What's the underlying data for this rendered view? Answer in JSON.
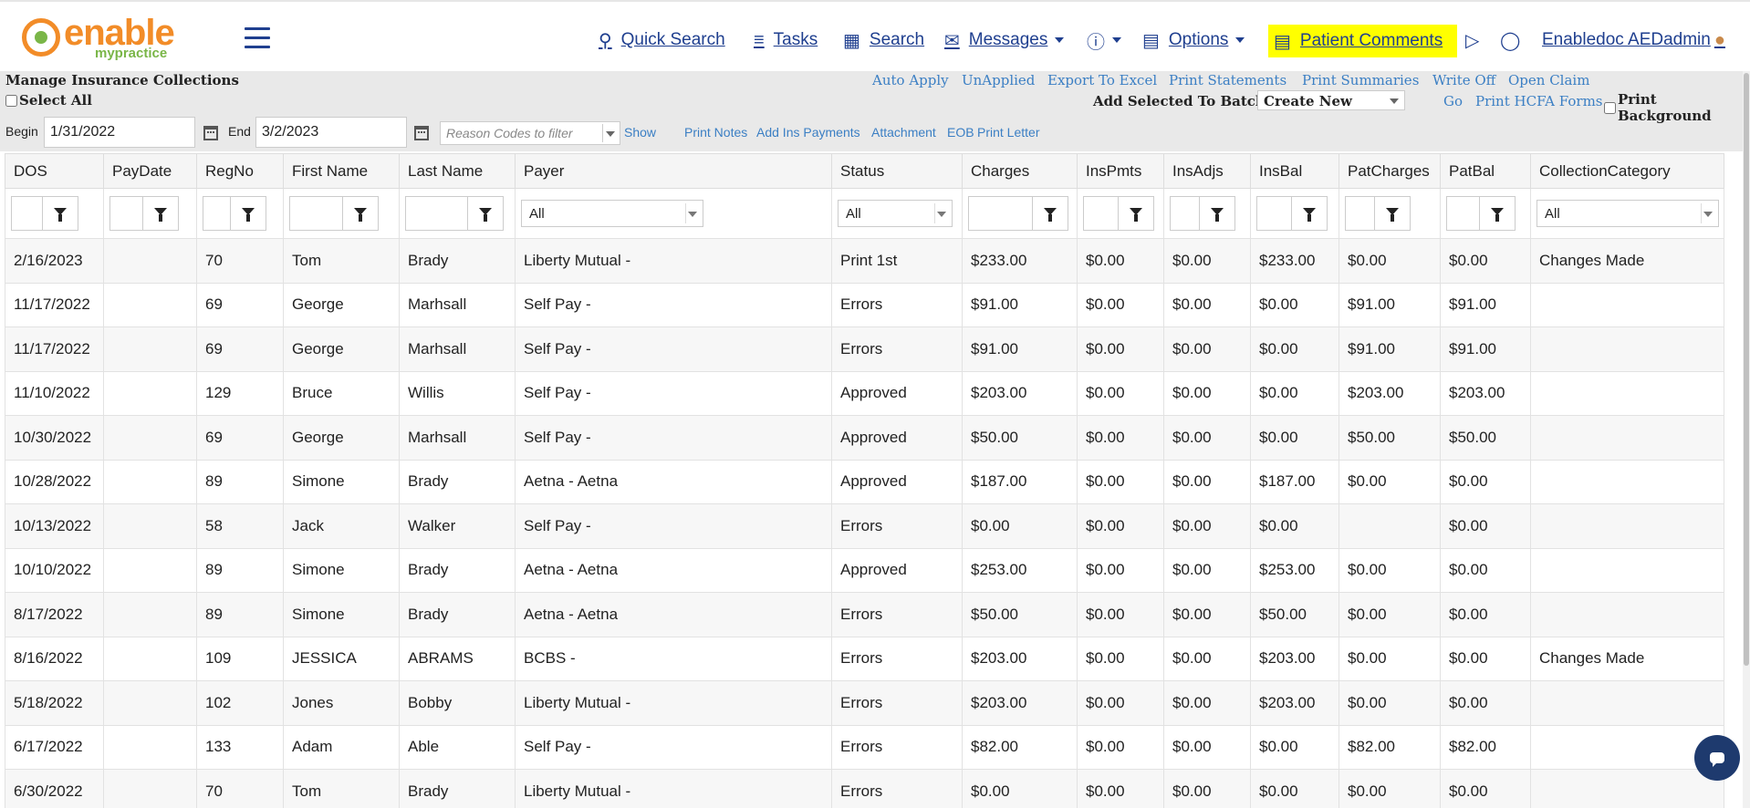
{
  "brand": {
    "name_top": "enable",
    "name_bottom": "mypractice"
  },
  "nav": {
    "quick_search": "Quick Search",
    "tasks": "Tasks",
    "search": "Search",
    "messages": "Messages",
    "options": "Options",
    "patient_comments": "Patient Comments",
    "user": "Enabledoc AEDadmin"
  },
  "page": {
    "title": "Manage Insurance Collections"
  },
  "toolbar": {
    "auto_apply": "Auto Apply",
    "unapplied": "UnApplied",
    "export_excel": "Export To Excel",
    "print_statements": "Print Statements",
    "print_summaries": "Print Summaries",
    "write_off": "Write Off",
    "open_claim": "Open Claim",
    "select_all": "Select All",
    "add_to_batch": "Add Selected To Batch",
    "batch_value": "Create New",
    "go": "Go",
    "print_hcfa": "Print HCFA Forms",
    "print_background": "Print Background"
  },
  "filters": {
    "begin_label": "Begin",
    "begin_value": "1/31/2022",
    "end_label": "End",
    "end_value": "3/2/2023",
    "reason_placeholder": "Reason Codes to filter",
    "show": "Show",
    "print_notes": "Print Notes",
    "add_ins_payments": "Add Ins Payments",
    "attachment": "Attachment",
    "eob": "EOB",
    "print_letter": "Print Letter"
  },
  "grid": {
    "columns": [
      "DOS",
      "PayDate",
      "RegNo",
      "First Name",
      "Last Name",
      "Payer",
      "Status",
      "Charges",
      "InsPmts",
      "InsAdjs",
      "InsBal",
      "PatCharges",
      "PatBal",
      "CollectionCategory"
    ],
    "filter_all": "All",
    "rows": [
      [
        "2/16/2023",
        "",
        "70",
        "Tom",
        "Brady",
        "Liberty Mutual -",
        "Print 1st",
        "$233.00",
        "$0.00",
        "$0.00",
        "$233.00",
        "$0.00",
        "$0.00",
        "Changes Made"
      ],
      [
        "11/17/2022",
        "",
        "69",
        "George",
        "Marhsall",
        "Self Pay -",
        "Errors",
        "$91.00",
        "$0.00",
        "$0.00",
        "$0.00",
        "$91.00",
        "$91.00",
        ""
      ],
      [
        "11/17/2022",
        "",
        "69",
        "George",
        "Marhsall",
        "Self Pay -",
        "Errors",
        "$91.00",
        "$0.00",
        "$0.00",
        "$0.00",
        "$91.00",
        "$91.00",
        ""
      ],
      [
        "11/10/2022",
        "",
        "129",
        "Bruce",
        "Willis",
        "Self Pay -",
        "Approved",
        "$203.00",
        "$0.00",
        "$0.00",
        "$0.00",
        "$203.00",
        "$203.00",
        ""
      ],
      [
        "10/30/2022",
        "",
        "69",
        "George",
        "Marhsall",
        "Self Pay -",
        "Approved",
        "$50.00",
        "$0.00",
        "$0.00",
        "$0.00",
        "$50.00",
        "$50.00",
        ""
      ],
      [
        "10/28/2022",
        "",
        "89",
        "Simone",
        "Brady",
        "Aetna - Aetna",
        "Approved",
        "$187.00",
        "$0.00",
        "$0.00",
        "$187.00",
        "$0.00",
        "$0.00",
        ""
      ],
      [
        "10/13/2022",
        "",
        "58",
        "Jack",
        "Walker",
        "Self Pay -",
        "Errors",
        "$0.00",
        "$0.00",
        "$0.00",
        "$0.00",
        "",
        "$0.00",
        ""
      ],
      [
        "10/10/2022",
        "",
        "89",
        "Simone",
        "Brady",
        "Aetna - Aetna",
        "Approved",
        "$253.00",
        "$0.00",
        "$0.00",
        "$253.00",
        "$0.00",
        "$0.00",
        ""
      ],
      [
        "8/17/2022",
        "",
        "89",
        "Simone",
        "Brady",
        "Aetna - Aetna",
        "Errors",
        "$50.00",
        "$0.00",
        "$0.00",
        "$50.00",
        "$0.00",
        "$0.00",
        ""
      ],
      [
        "8/16/2022",
        "",
        "109",
        "JESSICA",
        "ABRAMS",
        "BCBS -",
        "Errors",
        "$203.00",
        "$0.00",
        "$0.00",
        "$203.00",
        "$0.00",
        "$0.00",
        "Changes Made"
      ],
      [
        "5/18/2022",
        "",
        "102",
        "Jones",
        "Bobby",
        "Liberty Mutual -",
        "Errors",
        "$203.00",
        "$0.00",
        "$0.00",
        "$203.00",
        "$0.00",
        "$0.00",
        ""
      ],
      [
        "6/17/2022",
        "",
        "133",
        "Adam",
        "Able",
        "Self Pay -",
        "Errors",
        "$82.00",
        "$0.00",
        "$0.00",
        "$0.00",
        "$82.00",
        "$82.00",
        ""
      ],
      [
        "6/30/2022",
        "",
        "70",
        "Tom",
        "Brady",
        "Liberty Mutual -",
        "Errors",
        "$0.00",
        "$0.00",
        "$0.00",
        "$0.00",
        "$0.00",
        "$0.00",
        ""
      ]
    ]
  },
  "colors": {
    "nav_text": "#1f3f8f",
    "link": "#3b7fc4",
    "highlight": "#ffff00",
    "logo_orange": "#f28c28",
    "logo_green": "#7ab648"
  }
}
